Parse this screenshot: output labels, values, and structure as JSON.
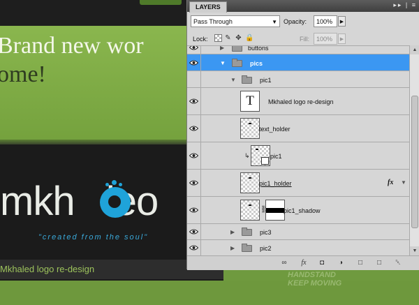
{
  "website": {
    "hero_line1": "Brand new wor",
    "hero_line2": "ome!",
    "logo_text": "mkh   leo",
    "tagline": "\"created from the soul\"",
    "caption": "Mkhaled logo re-design",
    "brand_stamp_1": "HANDSTAND",
    "brand_stamp_2": "KEEP MOVING"
  },
  "panel": {
    "tab_title": "LAYERS",
    "title_icons": "▸▸ | ≡",
    "blend_mode": "Pass Through",
    "opacity_label": "Opacity:",
    "opacity_value": "100%",
    "lock_label": "Lock:",
    "fill_label": "Fill:",
    "fill_value": "100%"
  },
  "layers": [
    {
      "name": "buttons",
      "type": "group",
      "expanded": false,
      "visible": true
    },
    {
      "name": "pics",
      "type": "group",
      "expanded": true,
      "visible": true,
      "selected": true
    },
    {
      "name": "pic1",
      "type": "group",
      "expanded": true,
      "visible": false
    },
    {
      "name": "Mkhaled logo re-design",
      "type": "text",
      "visible": true
    },
    {
      "name": "text_holder",
      "type": "layer",
      "visible": true
    },
    {
      "name": "pic1",
      "type": "smart-object",
      "clipped": true,
      "visible": true
    },
    {
      "name": "pic1_holder",
      "type": "layer",
      "visible": true,
      "effects": "fx"
    },
    {
      "name": "pic1_shadow",
      "type": "layer-with-mask",
      "visible": true
    },
    {
      "name": "pic3",
      "type": "group",
      "expanded": false,
      "visible": true
    },
    {
      "name": "pic2",
      "type": "group",
      "expanded": false,
      "visible": true
    }
  ],
  "colors": {
    "selection": "#3b97f2",
    "panel_bg": "#d6d6d6",
    "hero_green": "#8ab64e",
    "logo_blue": "#1fa3d9"
  },
  "icons": {
    "bottom_bar": [
      "link-layers-icon",
      "fx-icon",
      "add-mask-icon",
      "adjustment-layer-icon",
      "new-group-icon",
      "new-layer-icon",
      "delete-layer-icon"
    ],
    "bottom_glyphs": [
      "∞",
      "fx",
      "◘",
      "◑",
      "□",
      "□",
      "␡"
    ]
  }
}
